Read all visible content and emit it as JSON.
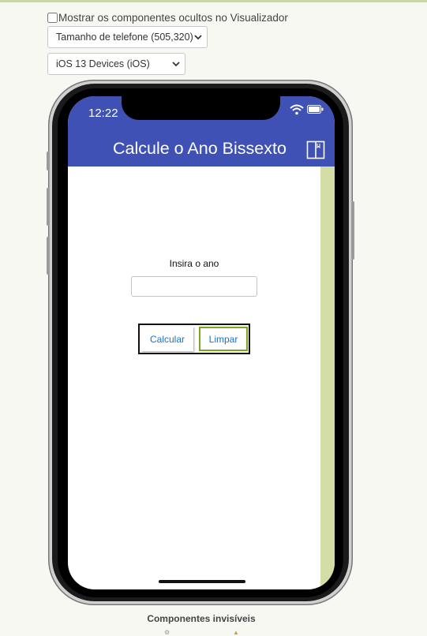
{
  "viewer": {
    "show_hidden_label": "Mostrar os componentes ocultos no Visualizador",
    "show_hidden_checked": false,
    "phone_size": "Tamanho de telefone (505,320)",
    "device": "iOS 13 Devices (iOS)"
  },
  "phone": {
    "status_time": "12:22",
    "app_title": "Calcule o Ano Bissexto",
    "prompt_label": "Insira o ano",
    "year_input_value": "",
    "calc_button": "Calcular",
    "clear_button": "Limpar"
  },
  "footer": {
    "invisible_components_label": "Componentes invisíveis"
  },
  "colors": {
    "appbar": "#3f51b5",
    "scrollbar": "#d2dea6",
    "button_text": "#1a73c7",
    "focus_border": "#7aa51d"
  },
  "icons": {
    "appbar_right": "book-icon",
    "status_right": [
      "wifi-icon",
      "battery-icon"
    ]
  }
}
